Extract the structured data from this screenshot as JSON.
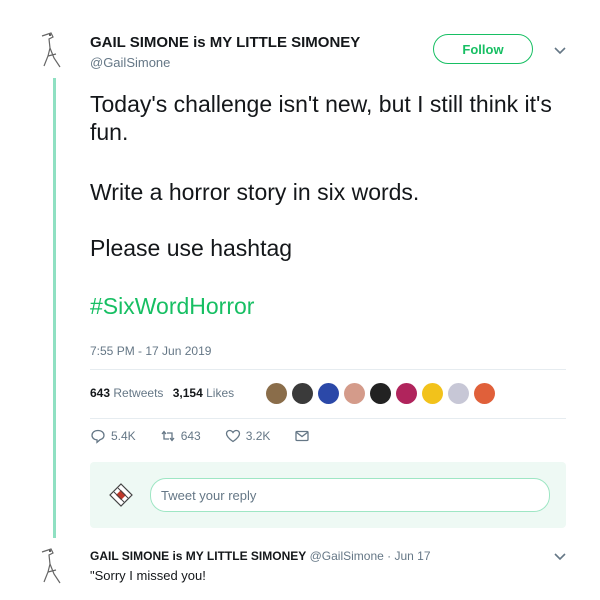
{
  "tweet": {
    "author": {
      "name": "GAIL SIMONE is MY LITTLE SIMONEY",
      "handle": "@GailSimone"
    },
    "follow_label": "Follow",
    "text": {
      "line1": "Today's challenge isn't new, but I still think it's fun.",
      "line2": "Write a horror story in six words.",
      "line3": "Please use hashtag",
      "hashtag": "#SixWordHorror"
    },
    "timestamp": "7:55 PM - 17 Jun 2019",
    "stats": {
      "retweets_count": "643",
      "retweets_label": "Retweets",
      "likes_count": "3,154",
      "likes_label": "Likes"
    },
    "actions": {
      "replies": "5.4K",
      "retweets": "643",
      "likes": "3.2K"
    }
  },
  "reply_box": {
    "placeholder": "Tweet your reply"
  },
  "reply": {
    "author_name": "GAIL SIMONE is MY LITTLE SIMONEY",
    "meta": "@GailSimone · Jun 17",
    "text": "\"Sorry I missed you!"
  },
  "colors": {
    "accent": "#17bf63",
    "thread_line": "#8fe0c2",
    "secondary_text": "#657786"
  },
  "icons": [
    "heron-avatar",
    "chevron-down-icon",
    "reply-icon",
    "retweet-icon",
    "like-icon",
    "dm-icon"
  ]
}
